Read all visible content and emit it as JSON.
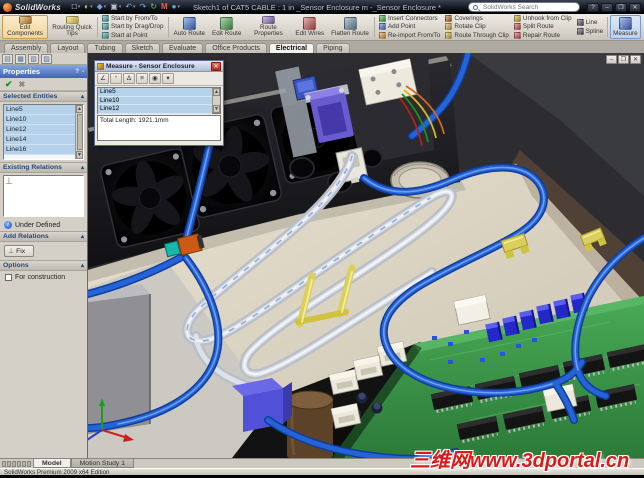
{
  "titlebar": {
    "app_name": "SolidWorks",
    "document_title": "Sketch1 of CAT5 CABLE : 1 in _Sensor Enclosure m -_Sensor Enclosure *",
    "search_placeholder": "SolidWorks Search",
    "help_button": "?",
    "help_caret": "▾",
    "minimize": "–",
    "restore": "❐",
    "close": "✕"
  },
  "qat": [
    {
      "name": "new-document-icon",
      "glyph": "□",
      "color": "#e8eef5"
    },
    {
      "name": "open-icon",
      "glyph": "◐",
      "color": "#e8c85a"
    },
    {
      "name": "save-icon",
      "glyph": "◆",
      "color": "#4a6fd0"
    },
    {
      "name": "print-icon",
      "glyph": "▣",
      "color": "#9aa2ac"
    },
    {
      "name": "undo-icon",
      "glyph": "↶",
      "color": "#4a8fd0"
    },
    {
      "name": "redo-icon",
      "glyph": "↷",
      "color": "#4a8fd0"
    },
    {
      "name": "rebuild-icon",
      "glyph": "↻",
      "color": "#3fae4a"
    },
    {
      "name": "mate-icon",
      "glyph": "M",
      "color": "#d03a2a"
    },
    {
      "name": "appearance-icon",
      "glyph": "●",
      "color": "#58b0d8"
    }
  ],
  "ribbon": {
    "edit_components": "Edit Components",
    "routing_quick_tips": "Routing Quick Tips",
    "start_by_from_to": "Start by From/To",
    "start_by_drag_drop": "Start by Drag/Drop",
    "start_at_point": "Start at Point",
    "auto_route": "Auto Route",
    "edit_route": "Edit Route",
    "route_properties": "Route Properties",
    "edit_wires": "Edit Wires",
    "flatten_route": "Flatten Route",
    "insert_connectors": "Insert Connectors",
    "add_point": "Add Point",
    "reimport_from_to": "Re-import From/To",
    "coverings": "Coverings",
    "rotate_clip": "Rotate Clip",
    "route_through_clip": "Route Through Clip",
    "unhook_from_clip": "Unhook from Clip",
    "split_route": "Split Route",
    "repair_route": "Repair Route",
    "line": "Line",
    "spline": "Spline",
    "measure": "Measure"
  },
  "ribbon_icon_colors": {
    "edit_components": "#d98f2e",
    "routing_quick_tips": "#e8d24a",
    "start_items": "#4aa0a0",
    "auto_route": "#3f6fd0",
    "edit_route": "#4f9e4f",
    "route_properties": "#8a6fc0",
    "edit_wires": "#c05050",
    "flatten_route": "#6a8aa0",
    "insert_connectors": "#3fae4a",
    "add_point": "#4a6fd0",
    "reimport_from_to": "#d98f2e",
    "coverings": "#b06a30",
    "rotate_clip": "#caa83a",
    "route_through_clip": "#caa83a",
    "unhook_from_clip": "#caa83a",
    "split_route": "#c05050",
    "repair_route": "#c05050",
    "line": "#555566",
    "spline": "#555566",
    "measure": "#4a6fd0"
  },
  "command_tabs": {
    "items": [
      "Assembly",
      "Layout",
      "Tubing",
      "Sketch",
      "Evaluate",
      "Office Products",
      "Electrical",
      "Piping"
    ],
    "active": "Electrical"
  },
  "property_panel": {
    "tab_icons": [
      "feature-tree-icon",
      "property-manager-icon",
      "configuration-icon",
      "display-pane-icon"
    ],
    "tab_glyphs": [
      "▤",
      "▦",
      "▧",
      "▨"
    ],
    "title": "Properties",
    "header_help": "?",
    "header_pin": "-",
    "ok_glyph": "✔",
    "cancel_glyph": "✖",
    "selected_entities_label": "Selected Entities",
    "selected_entities": [
      "Line5",
      "Line10",
      "Line12",
      "Line14",
      "Line16"
    ],
    "existing_relations_label": "Existing Relations",
    "relation_glyph": "⊥",
    "status_text": "Under Defined",
    "info_glyph": "i",
    "add_relations_label": "Add Relations",
    "fix_button": "Fix",
    "fix_glyph": "⊥",
    "options_label": "Options",
    "for_construction_label": "For construction",
    "collapse_glyph": "▴",
    "scroll_up": "▲",
    "scroll_down": "▼"
  },
  "measure_dialog": {
    "title": "Measure - Sensor Enclosure",
    "close_glyph": "✕",
    "toolbar_icons": [
      "arc-measure-icon",
      "units-icon",
      "delta-xyz-icon",
      "show-history-icon",
      "center-to-center-icon",
      "dropdown-icon"
    ],
    "toolbar_glyphs": [
      "∠",
      "°",
      "Δ",
      "≡",
      "◉",
      "▾"
    ],
    "entities": [
      "Line5",
      "Line10",
      "Line12"
    ],
    "result_line": "Total Length: 1921.1mm",
    "scroll_up": "▲",
    "scroll_down": "▼"
  },
  "viewport": {
    "controls": {
      "minimize": "–",
      "restore": "❐",
      "close": "✕"
    },
    "scene_objects": [
      "cooling-fan",
      "rear-panel",
      "dsub-connector",
      "terminal-block",
      "cable-gland",
      "rj45-connector",
      "braided-cable-loop",
      "blue-cable",
      "cable-clip",
      "grommet",
      "pcb",
      "relay-bank",
      "ic-chip",
      "capacitor",
      "origin-triad"
    ],
    "scene_colors": {
      "cable_blue": "#1c4fd0",
      "bundle_silver": "#d7dbe2",
      "clip_yellow": "#d9cf5a",
      "pcb_green": "#3f9e4b",
      "floor_beige": "#ddd6c6",
      "panel_black": "#1a1a1d",
      "connector_purple": "#6a5bd0"
    }
  },
  "bottom_bar": {
    "tabs": [
      "Model",
      "Motion Study 1"
    ],
    "active": "Model",
    "status": "SolidWorks Premium 2009 x64 Edition"
  },
  "watermark": {
    "text": "三维网www.3dportal.cn",
    "color": "#dd1a1a"
  }
}
